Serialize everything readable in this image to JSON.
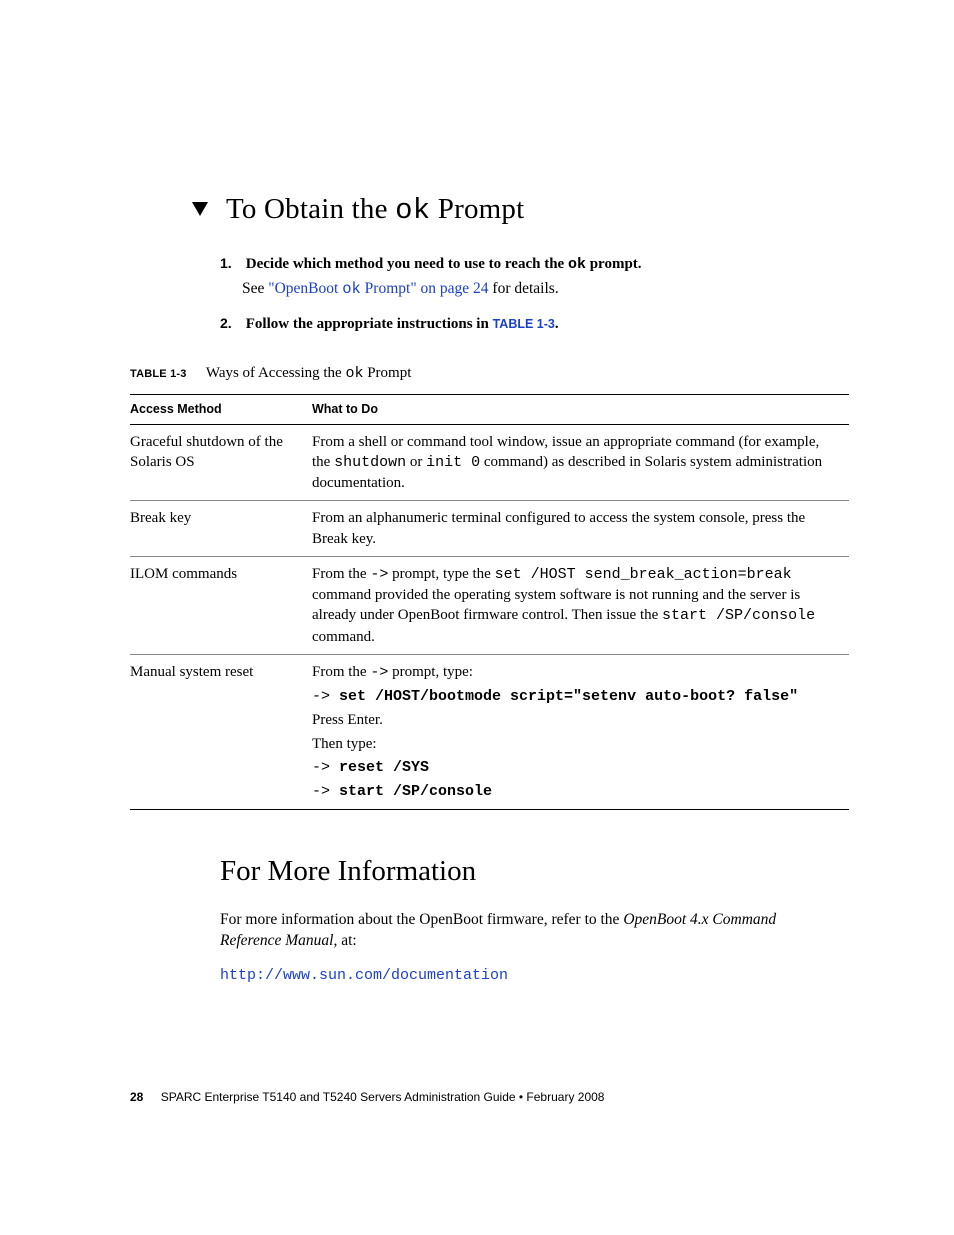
{
  "title": {
    "pre": "To Obtain the ",
    "code": "ok",
    "post": " Prompt"
  },
  "steps": [
    {
      "num": "1.",
      "lead_pre": "Decide which method you need to use to reach the ",
      "lead_code": "ok",
      "lead_post": " prompt.",
      "sub_pre": "See ",
      "sub_link_open": "\"OpenBoot ",
      "sub_link_code": "ok",
      "sub_link_close": " Prompt\" on page 24",
      "sub_post": " for details."
    },
    {
      "num": "2.",
      "lead_pre": "Follow the appropriate instructions in ",
      "lead_link": "TABLE 1-3",
      "lead_post": "."
    }
  ],
  "table_caption": {
    "label": "TABLE 1-3",
    "text_pre": "Ways of Accessing the ",
    "text_code": "ok",
    "text_post": " Prompt"
  },
  "table": {
    "headers": [
      "Access Method",
      "What to Do"
    ],
    "rows": [
      {
        "method": "Graceful shutdown of the Solaris OS",
        "desc": {
          "t1": "From a shell or command tool window, issue an appropriate command (for example, the ",
          "c1": "shutdown",
          "t2": " or ",
          "c2": "init 0",
          "t3": " command) as described in Solaris system administration documentation."
        }
      },
      {
        "method": "Break key",
        "desc": {
          "t1": "From an alphanumeric terminal configured to access the system console, press the Break key."
        }
      },
      {
        "method": "ILOM commands",
        "desc": {
          "t1": "From the ",
          "c1": "->",
          "t2": " prompt, type the ",
          "c2": "set /HOST send_break_action=break",
          "t3": " command provided the operating system software is not running and the server is already under OpenBoot firmware control. Then issue the ",
          "c3": "start /SP/console",
          "t4": " command."
        }
      },
      {
        "method": "Manual system reset",
        "desc": {
          "t1": "From the ",
          "c1": "->",
          "t2": " prompt, type:",
          "line1_arrow": "-> ",
          "line1_cmd": "set /HOST/bootmode script=\"setenv auto-boot? false\"",
          "press": "Press Enter.",
          "then": "Then type:",
          "line2_arrow": "-> ",
          "line2_cmd": "reset /SYS",
          "line3_arrow": "-> ",
          "line3_cmd": "start /SP/console"
        }
      }
    ]
  },
  "more": {
    "heading": "For More Information",
    "p1_a": "For more information about the OpenBoot firmware, refer to the ",
    "p1_ital": "OpenBoot 4.x Command Reference Manual",
    "p1_b": ", at:",
    "url": "http://www.sun.com/documentation"
  },
  "footer": {
    "page": "28",
    "text": "SPARC Enterprise T5140 and T5240 Servers Administration Guide • February 2008"
  }
}
